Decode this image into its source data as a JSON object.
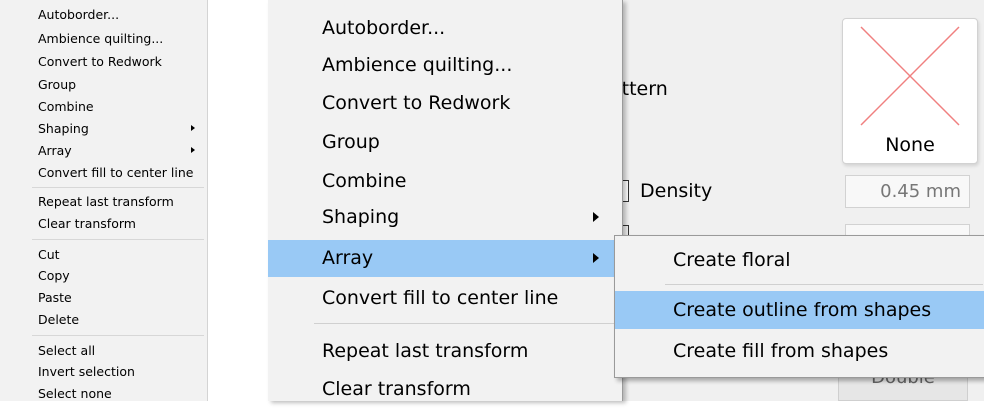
{
  "small_menu": {
    "items": [
      {
        "label": "Autoborder..."
      },
      {
        "label": "Ambience quilting..."
      },
      {
        "label": "Convert to Redwork"
      },
      {
        "label": "Group"
      },
      {
        "label": "Combine"
      },
      {
        "label": "Shaping",
        "has_submenu": true
      },
      {
        "label": "Array",
        "has_submenu": true
      },
      {
        "label": "Convert fill to center line"
      },
      {
        "label": "Repeat last transform"
      },
      {
        "label": "Clear transform"
      },
      {
        "label": "Cut"
      },
      {
        "label": "Copy"
      },
      {
        "label": "Paste"
      },
      {
        "label": "Delete"
      },
      {
        "label": "Select all"
      },
      {
        "label": "Invert selection"
      },
      {
        "label": "Select none"
      }
    ]
  },
  "context_menu": {
    "items": [
      {
        "label": "Autoborder..."
      },
      {
        "label": "Ambience quilting..."
      },
      {
        "label": "Convert to Redwork"
      },
      {
        "label": "Group"
      },
      {
        "label": "Combine"
      },
      {
        "label": "Shaping",
        "has_submenu": true
      },
      {
        "label": "Array",
        "has_submenu": true,
        "highlighted": true
      },
      {
        "label": "Convert fill to center line"
      },
      {
        "label": "Repeat last transform"
      },
      {
        "label": "Clear transform"
      }
    ]
  },
  "array_submenu": {
    "items": [
      {
        "label": "Create floral"
      },
      {
        "label": "Create outline from shapes",
        "highlighted": true
      },
      {
        "label": "Create fill from shapes"
      }
    ]
  },
  "dialog": {
    "pattern_label_partial": "attern",
    "pattern_tile_label": "None",
    "density_label": "Density",
    "density_value": "0.45 mm",
    "double_button_label": "Double"
  },
  "colors": {
    "menu_bg": "#f2f2f2",
    "highlight": "#99c9f5",
    "none_cross": "#f08080"
  }
}
